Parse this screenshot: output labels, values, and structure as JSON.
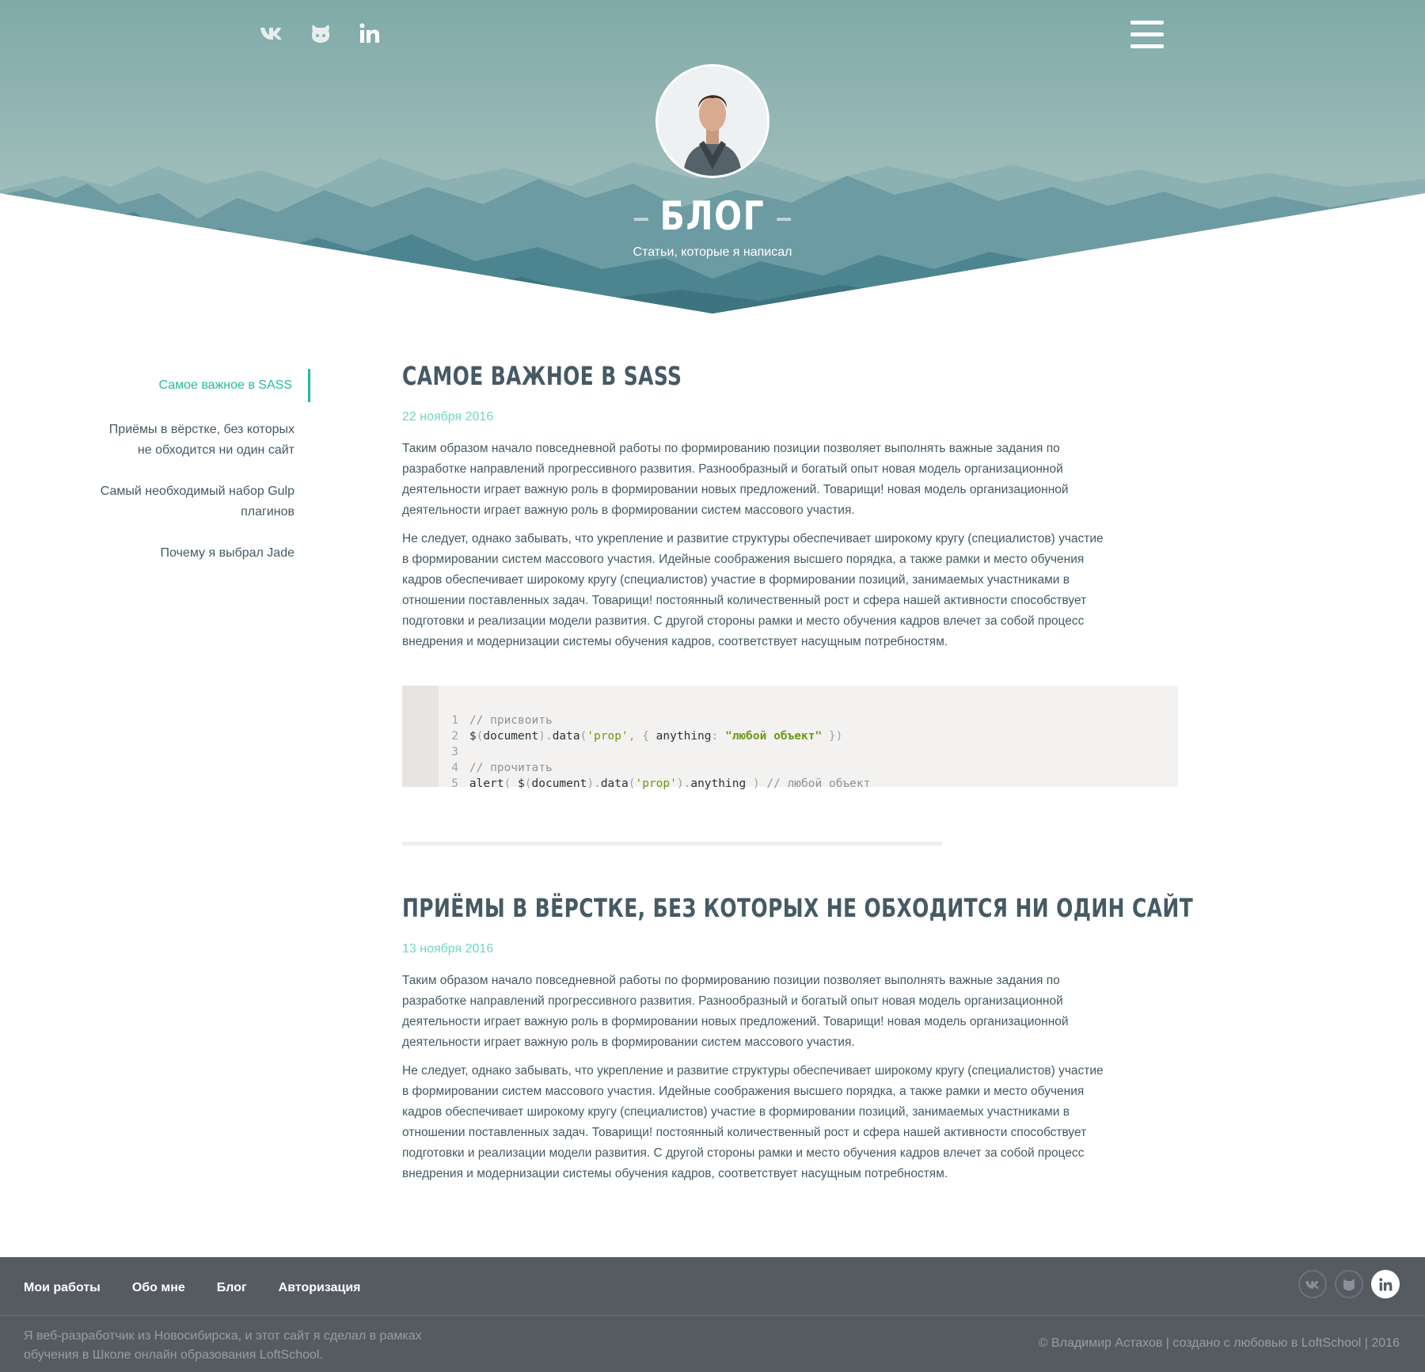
{
  "hero": {
    "title": "БЛОГ",
    "subtitle": "Статьи, которые я написал",
    "social": [
      "vk-icon",
      "github-icon",
      "linkedin-icon"
    ],
    "menu_icon": "hamburger-menu-icon"
  },
  "sidebar": {
    "items": [
      {
        "label": "Самое важное в SASS",
        "active": true
      },
      {
        "label": "Приёмы в вёрстке, без которых не обходится ни один сайт",
        "active": false
      },
      {
        "label": "Самый необходимый набор Gulp плагинов",
        "active": false
      },
      {
        "label": "Почему я выбрал Jade",
        "active": false
      }
    ]
  },
  "articles": [
    {
      "title": "САМОЕ ВАЖНОЕ В SASS",
      "date": "22 ноября 2016",
      "paragraphs": [
        "Таким образом начало повседневной работы по формированию позиции позволяет выполнять важные задания по разработке направлений прогрессивного развития. Разнообразный и богатый опыт новая модель организационной деятельности играет важную роль в формировании новых предложений. Товарищи! новая модель организационной деятельности играет важную роль в формировании систем массового участия.",
        "Не следует, однако забывать, что укрепление и развитие структуры обеспечивает широкому кругу (специалистов) участие в формировании систем массового участия. Идейные соображения высшего порядка, а также рамки и место обучения кадров обеспечивает широкому кругу (специалистов) участие в формировании позиций, занимаемых участниками в отношении поставленных задач. Товарищи! постоянный количественный рост и сфера нашей активности способствует подготовки и реализации модели развития. С другой стороны рамки и место обучения кадров влечет за собой процесс внедрения и модернизации системы обучения кадров, соответствует насущным потребностям."
      ]
    },
    {
      "title": "ПРИЁМЫ В ВЁРСТКЕ, БЕЗ КОТОРЫХ НЕ ОБХОДИТСЯ НИ ОДИН САЙТ",
      "date": "13 ноября 2016",
      "paragraphs": [
        "Таким образом начало повседневной работы по формированию позиции позволяет выполнять важные задания по разработке направлений прогрессивного развития. Разнообразный и богатый опыт новая модель организационной деятельности играет важную роль в формировании новых предложений. Товарищи! новая модель организационной деятельности играет важную роль в формировании систем массового участия.",
        "Не следует, однако забывать, что укрепление и развитие структуры обеспечивает широкому кругу (специалистов) участие в формировании систем массового участия. Идейные соображения высшего порядка, а также рамки и место обучения кадров обеспечивает широкому кругу (специалистов) участие в формировании позиций, занимаемых участниками в отношении поставленных задач. Товарищи! постоянный количественный рост и сфера нашей активности способствует подготовки и реализации модели развития. С другой стороны рамки и место обучения кадров влечет за собой процесс внедрения и модернизации системы обучения кадров, соответствует насущным потребностям."
      ]
    }
  ],
  "code": {
    "line_numbers": [
      "1",
      "2",
      "3",
      "4",
      "5"
    ],
    "l1_comment": "// присвоить",
    "l2_a": "$",
    "l2_b": "(",
    "l2_c": "document",
    "l2_d": ").",
    "l2_e": "data",
    "l2_f": "(",
    "l2_g": "'prop'",
    "l2_h": ", { ",
    "l2_i": "anything",
    "l2_j": ": ",
    "l2_k": "\"любой объект\"",
    "l2_l": " })",
    "l4_comment": "// прочитать",
    "l5_a": "alert",
    "l5_b": "( ",
    "l5_c": "$",
    "l5_d": "(",
    "l5_e": "document",
    "l5_f": ").",
    "l5_g": "data",
    "l5_h": "(",
    "l5_i": "'prop'",
    "l5_j": ").",
    "l5_k": "anything",
    "l5_l": " ) ",
    "l5_m": "// любой объект"
  },
  "footer": {
    "nav": [
      "Мои работы",
      "Обо мне",
      "Блог",
      "Авторизация"
    ],
    "about": "Я веб-разработчик из Новосибирска, и этот сайт я сделал в рамках обучения в Школе онлайн образования LoftSchool.",
    "copyright": "© Владимир Астахов | создано с любовью в LoftSchool | 2016",
    "social": [
      "vk-icon",
      "github-icon",
      "linkedin-icon"
    ]
  },
  "colors": {
    "accent": "#26b9a0",
    "date": "#6fd6c2",
    "text": "#455a64",
    "sky_top": "#80aaa9",
    "mountains": "#3f7a86",
    "footer_bg": "#555b60"
  }
}
